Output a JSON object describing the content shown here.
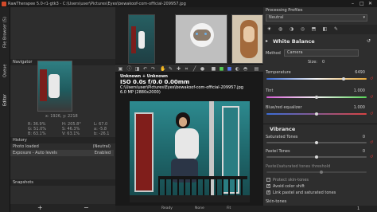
{
  "window": {
    "title": "RawTherapee 5.0-r1-gtk3 - C:\\Users\\user\\Pictures\\Eyes\\bewakoof-com-official-209957.jpg",
    "colors": {
      "accent": "#4f9fd8",
      "panel": "#2e2e2e"
    }
  },
  "left_tabs": [
    "File Browser (5)",
    "Queue",
    "Editor"
  ],
  "navigator": {
    "label": "Navigator",
    "coords": "x: 1926, y: 2218",
    "stats": [
      {
        "k": "R:",
        "v": "36.9%",
        "k2": "H:",
        "v2": "205.8°",
        "k3": "L:",
        "v3": "67.0"
      },
      {
        "k": "G:",
        "v": "51.0%",
        "k2": "S:",
        "v2": "46.3%",
        "k3": "a:",
        "v3": "-5.8"
      },
      {
        "k": "B:",
        "v": "63.1%",
        "k2": "V:",
        "v2": "63.1%",
        "k3": "b:",
        "v3": "-26.1"
      }
    ]
  },
  "history": {
    "label": "History",
    "rows": [
      {
        "action": "Photo loaded",
        "value": "(Neutral)"
      },
      {
        "action": "Exposure - Auto levels",
        "value": "Enabled"
      }
    ]
  },
  "snapshots": {
    "label": "Snapshots",
    "add": "+",
    "remove": "−"
  },
  "overlay": {
    "line1": "Unknown + Unknown",
    "line2": "ISO 0.0s f/0.0 0.00mm",
    "line3": "C:\\Users\\user\\Pictures\\Eyes\\bewakoof-com-official-209957.jpg",
    "line4": "6.0 MP (2880x2000)"
  },
  "statusbar": {
    "ready": "Ready",
    "noise": "None",
    "zoom": "Fit"
  },
  "right": {
    "profiles_label": "Processing Profiles",
    "profile_value": "Neutral",
    "wb_title": "White Balance",
    "method_label": "Method",
    "method_value": "Camera",
    "size_label": "Size:",
    "size_value": "0",
    "temp_label": "Temperature",
    "temp_value": "6490",
    "tint_label": "Tint",
    "tint_value": "1.000",
    "blue_red_label": "Blue/red equalizer",
    "blue_red_value": "1.000",
    "vibrance_title": "Vibrance",
    "saturated_label": "Saturated Tones",
    "saturated_value": "0",
    "pastel_label": "Pastel Tones",
    "pastel_value": "0",
    "threshold_label": "Pastel/saturated tones threshold",
    "protect_label": "Protect skin-tones",
    "avoid_label": "Avoid color shift",
    "link_label": "Link pastel and saturated tones",
    "skin_label": "Skin-tones",
    "page": "1"
  },
  "levels": {
    "temperature": 0.78,
    "tint": 0.5,
    "blue_red": 0.5,
    "saturated": 0.5,
    "pastel": 0.5,
    "threshold": 0.55
  }
}
